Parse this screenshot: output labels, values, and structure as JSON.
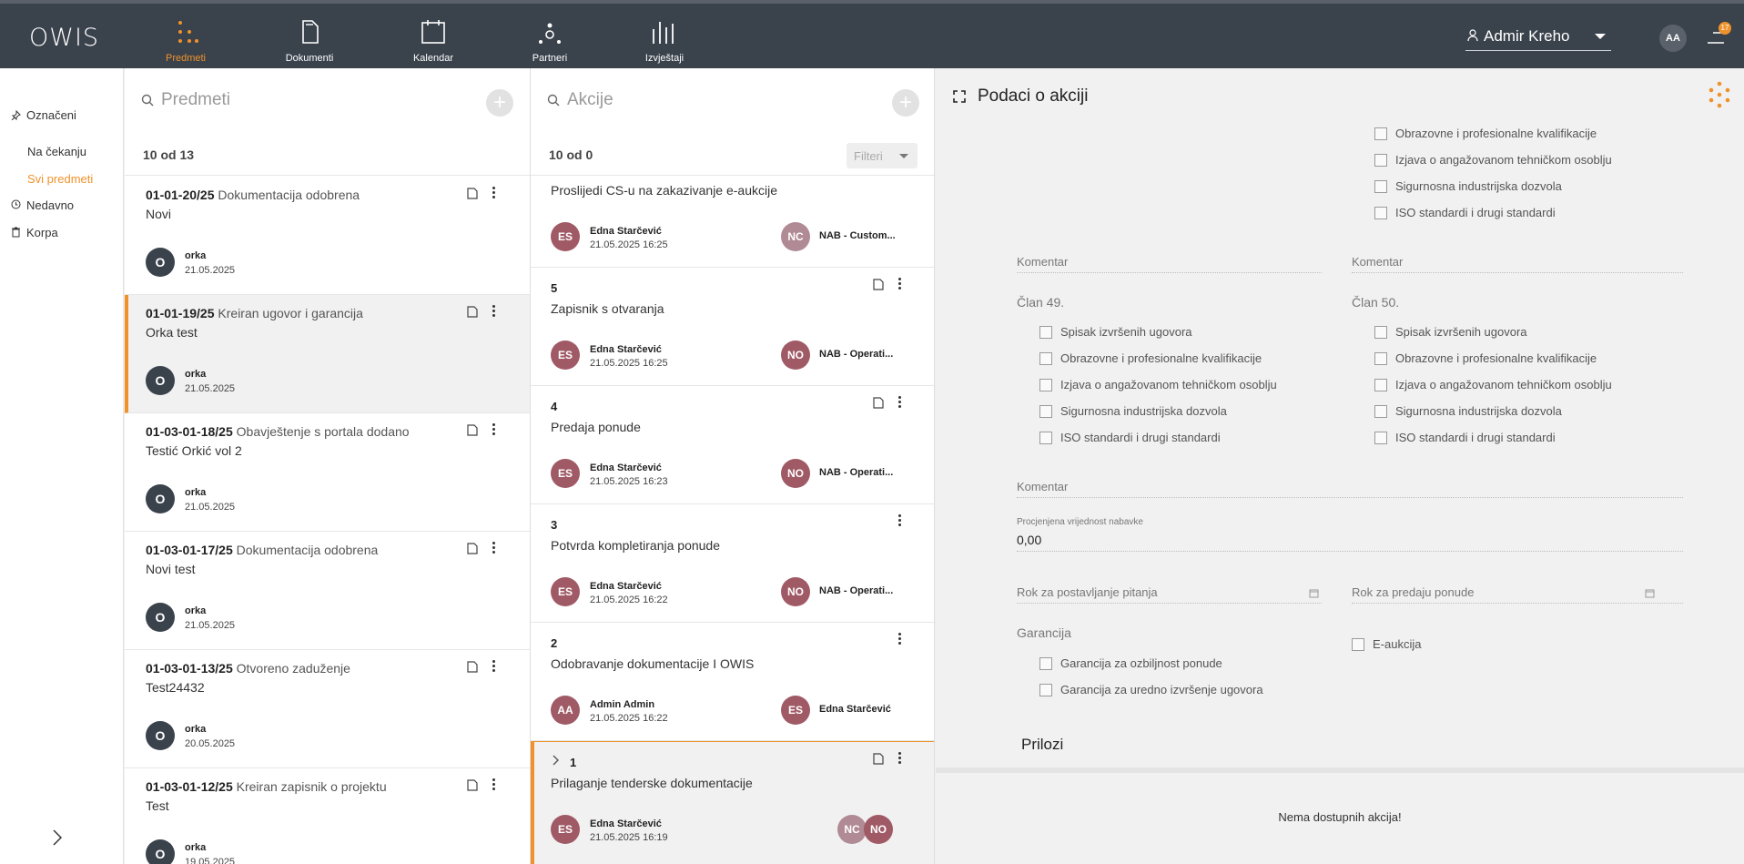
{
  "header": {
    "logo": "OWIS",
    "nav": [
      {
        "label": "Predmeti",
        "icon": "grid-dots-icon",
        "active": true
      },
      {
        "label": "Dokumenti",
        "icon": "document-icon",
        "active": false
      },
      {
        "label": "Kalendar",
        "icon": "calendar-icon",
        "active": false
      },
      {
        "label": "Partneri",
        "icon": "partners-icon",
        "active": false
      },
      {
        "label": "Izvještaji",
        "icon": "reports-icon",
        "active": false
      }
    ],
    "user_name": "Admir Kreho",
    "avatar_initials": "AA",
    "notification_count": "17",
    "accent_color": "#f0922b"
  },
  "sidebar": {
    "items": [
      {
        "label": "Označeni",
        "icon": "pin-icon"
      },
      {
        "label": "Na čekanju"
      },
      {
        "label": "Svi predmeti",
        "active": true
      },
      {
        "label": "Nedavno",
        "icon": "history-icon"
      },
      {
        "label": "Korpa",
        "icon": "trash-icon"
      }
    ]
  },
  "predmeti": {
    "search_placeholder": "Predmeti",
    "count": "10 od 13",
    "cards": [
      {
        "code": "01-01-20/25",
        "status": "Dokumentacija odobrena",
        "name": "Novi",
        "initial": "O",
        "user": "orka",
        "date": "21.05.2025"
      },
      {
        "code": "01-01-19/25",
        "status": "Kreiran ugovor i garancija",
        "name": "Orka test",
        "initial": "O",
        "user": "orka",
        "date": "21.05.2025"
      },
      {
        "code": "01-03-01-18/25",
        "status": "Obavještenje s portala dodano",
        "name": "Testić Orkić vol 2",
        "initial": "O",
        "user": "orka",
        "date": "21.05.2025"
      },
      {
        "code": "01-03-01-17/25",
        "status": "Dokumentacija odobrena",
        "name": "Novi test",
        "initial": "O",
        "user": "orka",
        "date": "21.05.2025"
      },
      {
        "code": "01-03-01-13/25",
        "status": "Otvoreno zaduženje",
        "name": "Test24432",
        "initial": "O",
        "user": "orka",
        "date": "20.05.2025"
      },
      {
        "code": "01-03-01-12/25",
        "status": "Kreiran zapisnik o projektu",
        "name": "Test",
        "initial": "O",
        "user": "orka",
        "date": "19.05.2025"
      }
    ]
  },
  "akcije": {
    "search_placeholder": "Akcije",
    "count": "10 od 0",
    "filter_label": "Filteri",
    "cards": [
      {
        "num": "6",
        "title": "Proslijedi CS-u na zakazivanje e-aukcije",
        "av1": "ES",
        "user": "Edna Starčević",
        "date": "21.05.2025 16:25",
        "av2": "NC",
        "team": "NAB - Custom..."
      },
      {
        "num": "5",
        "title": "Zapisnik s otvaranja",
        "av1": "ES",
        "user": "Edna Starčević",
        "date": "21.05.2025 16:25",
        "av2": "NO",
        "team": "NAB - Operati..."
      },
      {
        "num": "4",
        "title": "Predaja ponude",
        "av1": "ES",
        "user": "Edna Starčević",
        "date": "21.05.2025 16:23",
        "av2": "NO",
        "team": "NAB - Operati..."
      },
      {
        "num": "3",
        "title": "Potvrda kompletiranja ponude",
        "av1": "ES",
        "user": "Edna Starčević",
        "date": "21.05.2025 16:22",
        "av2": "NO",
        "team": "NAB - Operati..."
      },
      {
        "num": "2",
        "title": "Odobravanje dokumentacije I OWIS",
        "av1": "AA",
        "user": "Admin Admin",
        "date": "21.05.2025 16:22",
        "av2": "ES",
        "team": "Edna Starčević"
      },
      {
        "num": "1",
        "title": "Prilaganje tenderske dokumentacije",
        "av1": "ES",
        "user": "Edna Starčević",
        "date": "21.05.2025 16:19",
        "av2": "NC",
        "av3": "NO"
      }
    ]
  },
  "detail": {
    "title": "Podaci o akciji",
    "top_checks": [
      "Obrazovne i profesionalne kvalifikacije",
      "Izjava o angažovanom tehničkom osoblju",
      "Sigurnosna industrijska dozvola",
      "ISO standardi i drugi standardi"
    ],
    "komentar": "Komentar",
    "clan49": "Član 49.",
    "clan50": "Član 50.",
    "checks": [
      "Spisak izvršenih ugovora",
      "Obrazovne i profesionalne kvalifikacije",
      "Izjava o angažovanom tehničkom osoblju",
      "Sigurnosna industrijska dozvola",
      "ISO standardi i drugi standardi"
    ],
    "procjena_label": "Procjenjena vrijednost nabavke",
    "procjena_value": "0,00",
    "rok_pitanja": "Rok za postavljanje pitanja",
    "rok_ponude": "Rok za predaju ponude",
    "garancija": "Garancija",
    "garancija_checks": [
      "Garancija za ozbiljnost ponude",
      "Garancija za uredno izvršenje ugovora"
    ],
    "eaukcija": "E-aukcija",
    "prilozi": "Prilozi",
    "empty": "Nema dostupnih akcija!"
  }
}
